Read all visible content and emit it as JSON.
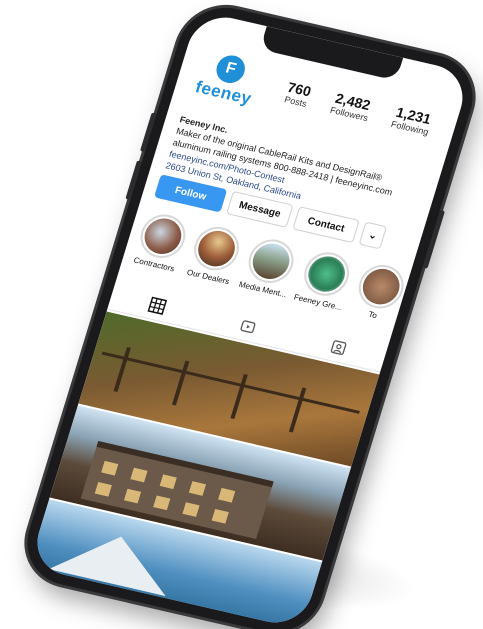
{
  "profile": {
    "brand": "feeney",
    "logo_mark": "F",
    "stats": [
      {
        "value": "760",
        "label": "Posts"
      },
      {
        "value": "2,482",
        "label": "Followers"
      },
      {
        "value": "1,231",
        "label": "Following"
      }
    ],
    "name": "Feeney Inc.",
    "bio_line1": "Maker of the original CableRail Kits and DesignRail®",
    "bio_line2": "aluminum railing systems 800-888-2418 | feeneyinc.com",
    "link": "feeneyinc.com/Photo-Contest",
    "address": "2603 Union St, Oakland, California"
  },
  "actions": {
    "follow": "Follow",
    "message": "Message",
    "contact": "Contact",
    "more": "⌄"
  },
  "highlights": [
    {
      "label": "Contractors"
    },
    {
      "label": "Our Dealers"
    },
    {
      "label": "Media Ment..."
    },
    {
      "label": "Feeney Gre..."
    },
    {
      "label": "To"
    }
  ],
  "tabs": [
    {
      "icon": "grid-icon"
    },
    {
      "icon": "reels-icon"
    },
    {
      "icon": "tagged-icon"
    }
  ],
  "colors": {
    "brand_blue": "#1f8fd8",
    "follow_blue": "#3897f0",
    "phone_body": "#1a1a1c"
  }
}
